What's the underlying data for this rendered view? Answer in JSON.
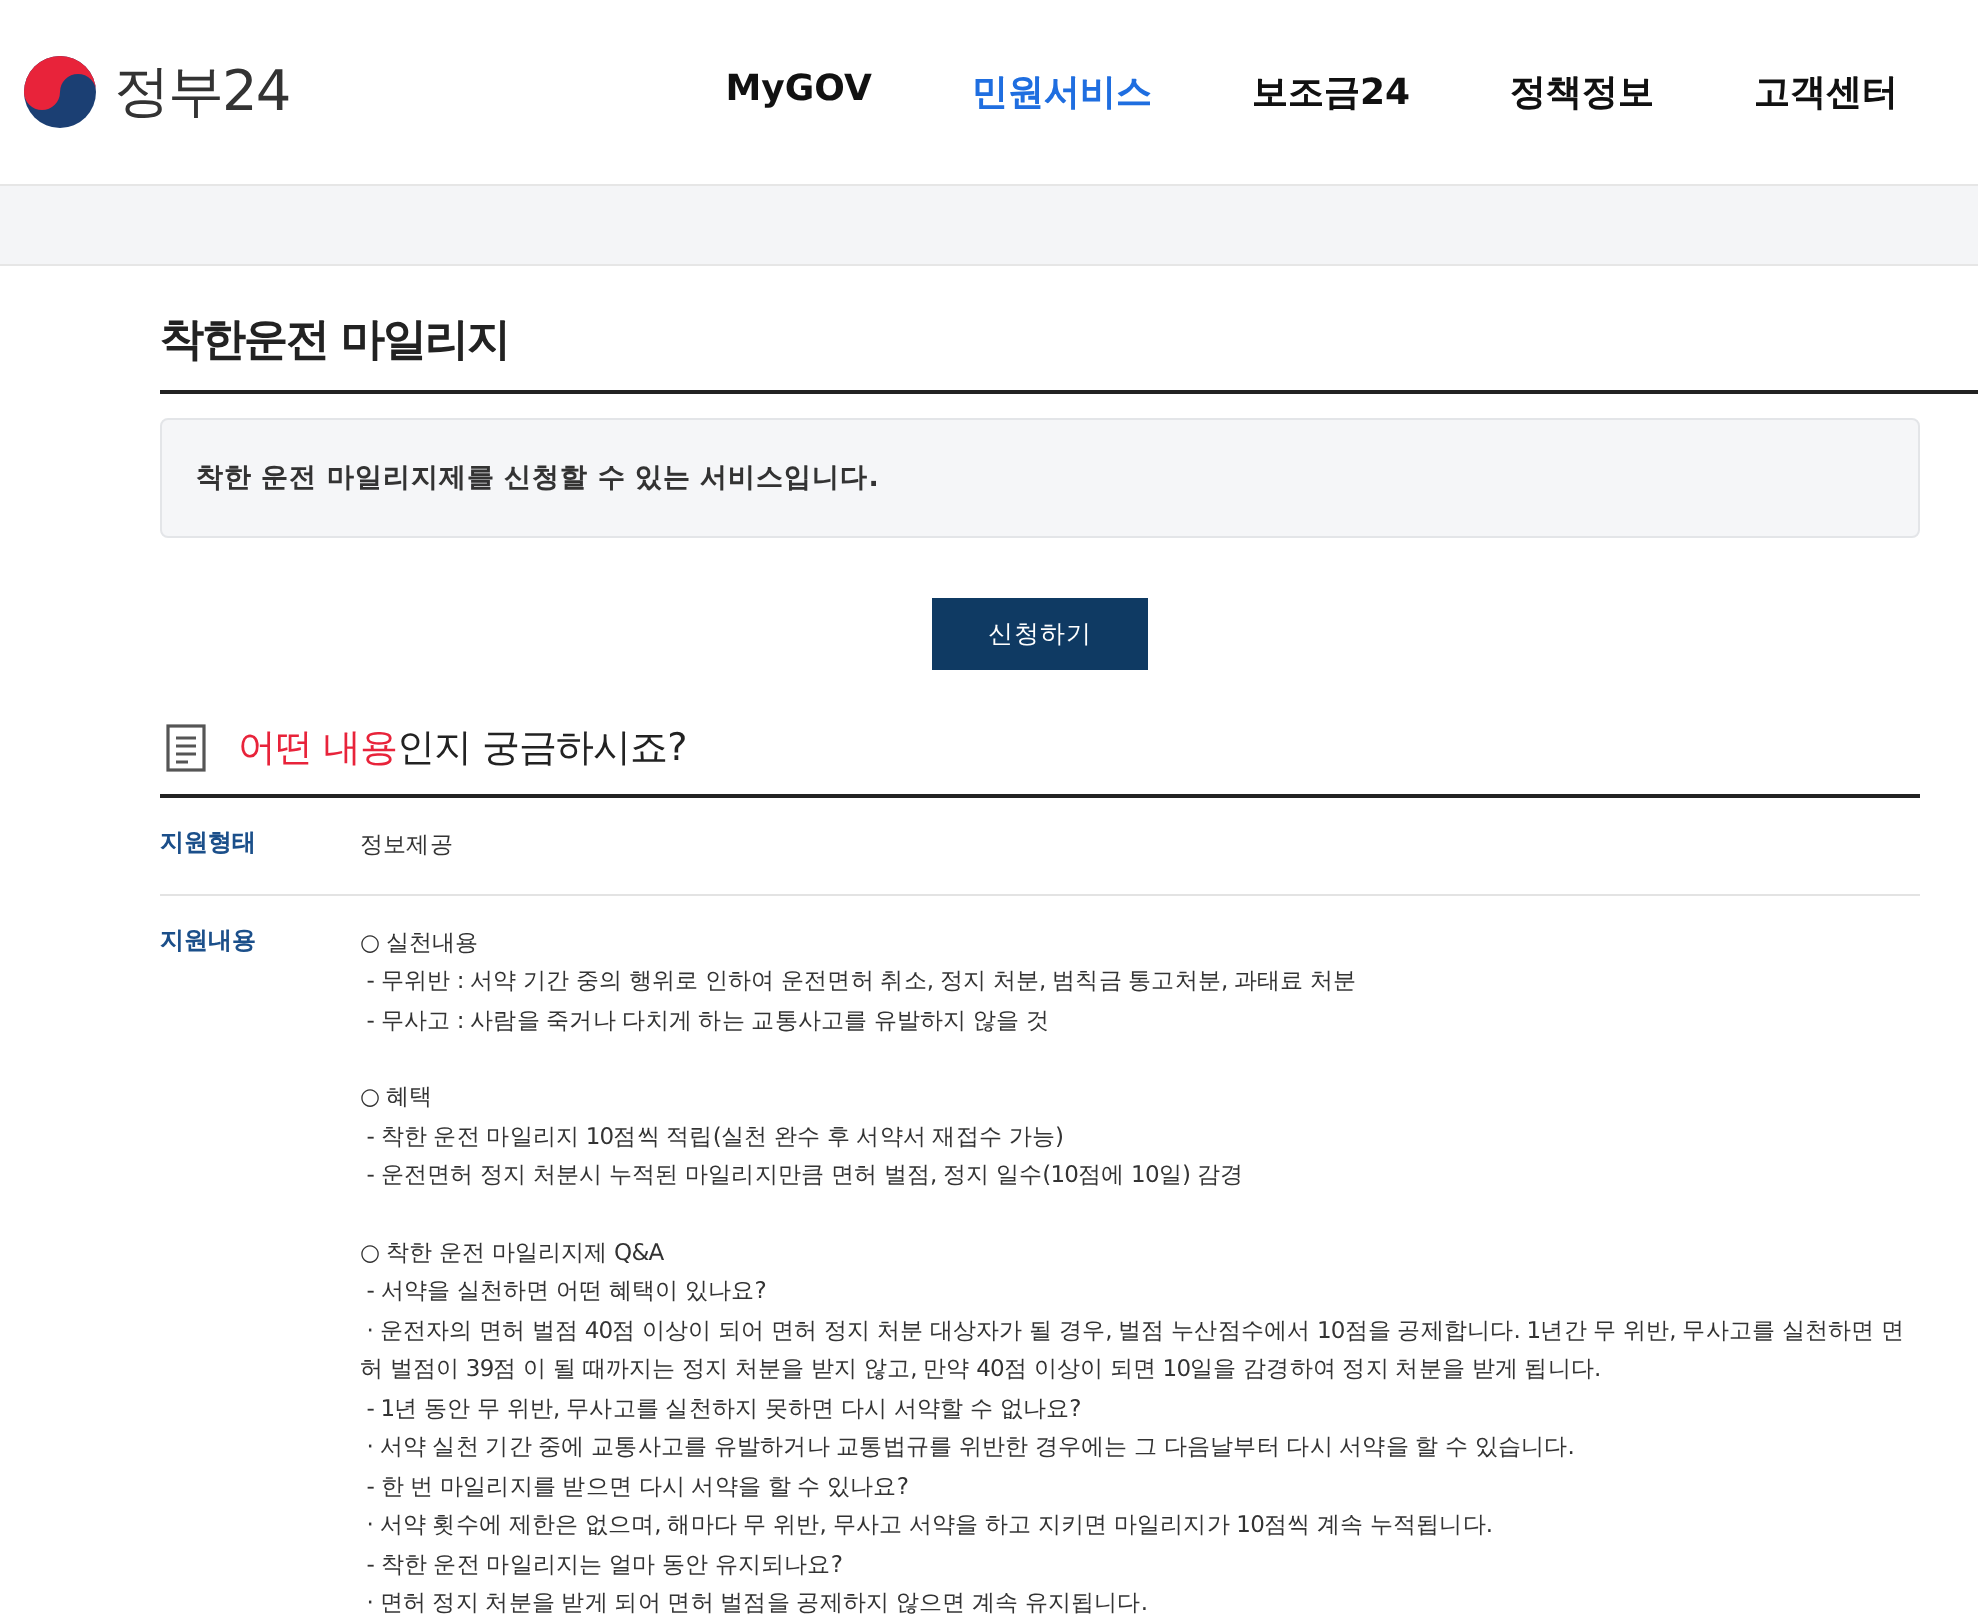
{
  "header": {
    "logo_text": "정부24",
    "nav": [
      {
        "label": "MyGOV",
        "selected": false
      },
      {
        "label": "민원서비스",
        "selected": true
      },
      {
        "label": "보조금24",
        "selected": false
      },
      {
        "label": "정책정보",
        "selected": false
      },
      {
        "label": "고객센터",
        "selected": false
      }
    ]
  },
  "page_title": "착한운전 마일리지",
  "summary": "착한 운전 마일리지제를 신청할 수 있는 서비스입니다.",
  "apply_button": "신청하기",
  "section": {
    "highlight": "어떤 내용",
    "rest": "인지 궁금하시죠?"
  },
  "details": [
    {
      "label": "지원형태",
      "paragraphs": [
        [
          "정보제공"
        ]
      ]
    },
    {
      "label": "지원내용",
      "paragraphs": [
        [
          "○ 실천내용",
          " - 무위반 : 서약 기간 중의 행위로 인하여 운전면허 취소, 정지 처분, 범칙금 통고처분, 과태료 처분",
          " - 무사고 : 사람을 죽거나 다치게 하는 교통사고를 유발하지 않을 것"
        ],
        [
          "○ 혜택",
          " - 착한 운전 마일리지 10점씩 적립(실천 완수 후 서약서 재접수 가능)",
          " - 운전면허 정지 처분시 누적된 마일리지만큼 면허 벌점, 정지 일수(10점에 10일) 감경"
        ],
        [
          "○ 착한 운전 마일리지제 Q&A",
          " - 서약을 실천하면 어떤 혜택이 있나요?",
          " · 운전자의 면허 벌점 40점 이상이 되어 면허 정지 처분 대상자가 될 경우, 벌점 누산점수에서 10점을 공제합니다. 1년간 무 위반, 무사고를 실천하면 면허 벌점이 39점 이 될 때까지는 정지 처분을 받지 않고, 만약 40점 이상이 되면 10일을 감경하여 정지 처분을 받게 됩니다.",
          " - 1년 동안 무 위반, 무사고를 실천하지 못하면 다시 서약할 수 없나요?",
          " · 서약 실천 기간 중에 교통사고를 유발하거나 교통법규를 위반한 경우에는 그 다음날부터 다시 서약을 할 수 있습니다.",
          " - 한 번 마일리지를 받으면 다시 서약을 할 수 있나요?",
          " · 서약 횟수에 제한은 없으며, 해마다 무 위반, 무사고 서약을 하고 지키면 마일리지가 10점씩 계속 누적됩니다.",
          " - 착한 운전 마일리지는 얼마 동안 유지되나요?",
          " · 면허 정지 처분을 받게 되어 면허 벌점을 공제하지 않으면 계속 유지됩니다."
        ]
      ]
    }
  ]
}
